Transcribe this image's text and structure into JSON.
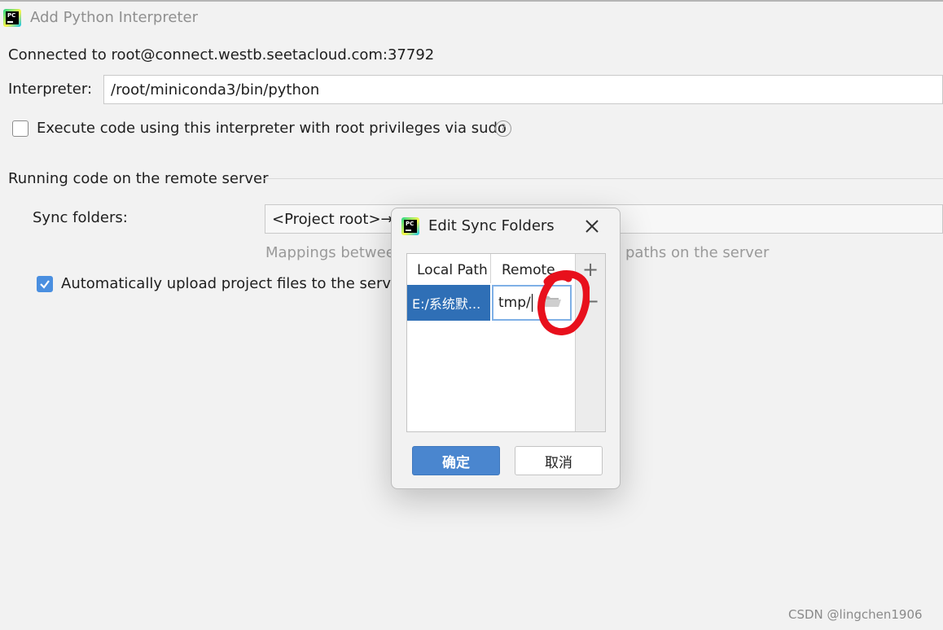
{
  "window": {
    "title": "Add Python Interpreter"
  },
  "connection": {
    "text": "Connected to root@connect.westb.seetacloud.com:37792"
  },
  "interpreter": {
    "label": "Interpreter:",
    "value": "/root/miniconda3/bin/python"
  },
  "sudo": {
    "label": "Execute code using this interpreter with root privileges via sudo",
    "checked": false,
    "help": "?"
  },
  "section": {
    "title": "Running code on the remote server"
  },
  "sync": {
    "label": "Sync folders:",
    "value": "<Project root>→",
    "hint_left": "Mappings betwee",
    "hint_right": "paths on the server"
  },
  "auto_upload": {
    "label": "Automatically upload project files to the server",
    "checked": true
  },
  "dialog": {
    "title": "Edit Sync Folders",
    "columns": [
      "Local Path",
      "Remote"
    ],
    "rows": [
      {
        "local": "E:/系统默...",
        "remote": "tmp/"
      }
    ],
    "add": "+",
    "remove": "−",
    "ok": "确定",
    "cancel": "取消"
  },
  "watermark": "CSDN @lingchen1906",
  "annotation_color": "#e8101c"
}
